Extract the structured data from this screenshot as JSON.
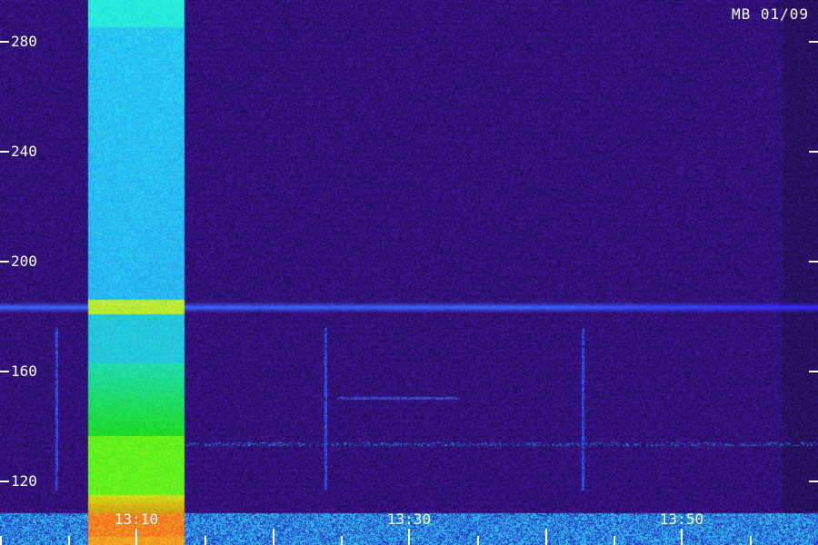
{
  "station_label": "MB 01/09",
  "y_axis": {
    "ticks": [
      {
        "value": 280,
        "label": "280"
      },
      {
        "value": 240,
        "label": "240"
      },
      {
        "value": 200,
        "label": "200"
      },
      {
        "value": 160,
        "label": "160"
      },
      {
        "value": 120,
        "label": "120"
      }
    ]
  },
  "x_axis": {
    "labels": [
      {
        "time": "13:10",
        "label": "13:10"
      },
      {
        "time": "13:30",
        "label": "13:30"
      },
      {
        "time": "13:50",
        "label": "13:50"
      }
    ]
  },
  "colors": {
    "background": "#1a0a4a",
    "noise": "#3a1a9a",
    "band_line": "#3a5aff",
    "burst_cyan": "#2ad8ff",
    "burst_green": "#20ff20",
    "burst_red": "#ff3010",
    "text": "#ffffff"
  }
}
